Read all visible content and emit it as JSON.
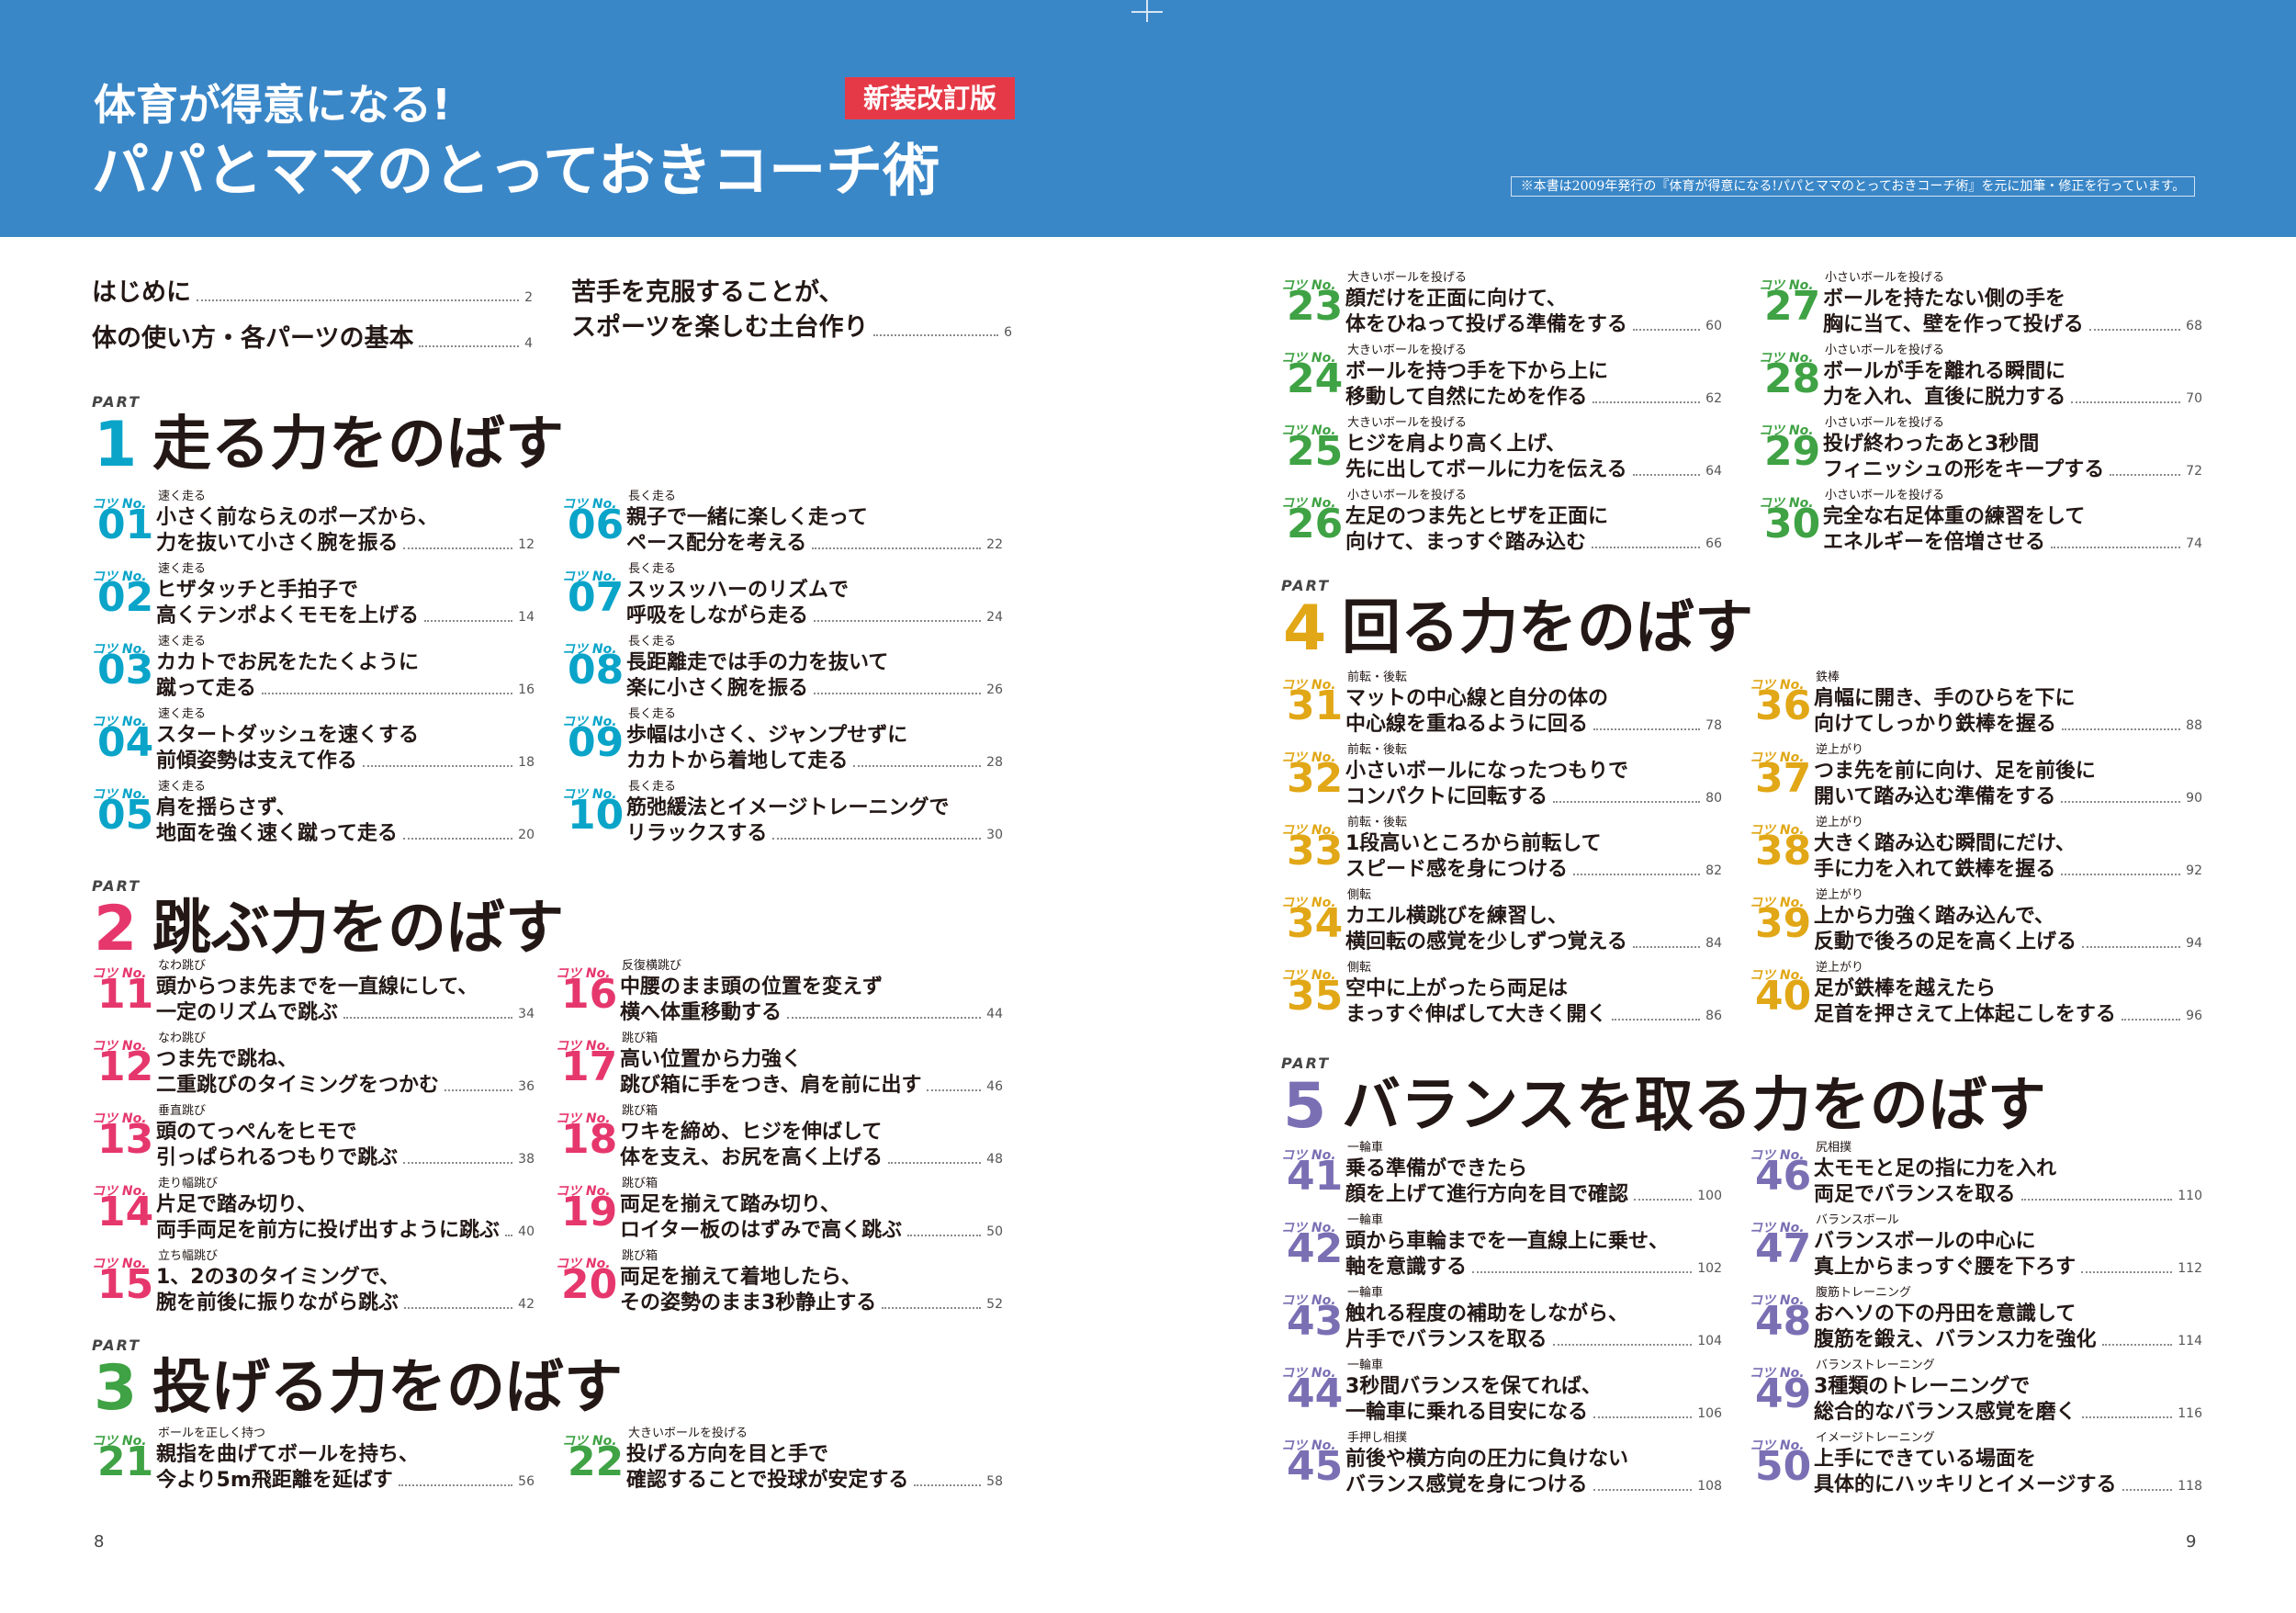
{
  "header": {
    "subtitle": "体育が得意になる!",
    "title": "パパとママのとっておきコーチ術",
    "edition_badge": "新装改訂版",
    "note": "※本書は2009年発行の『体育が得意になる!パパとママのとっておきコーチ術』を元に加筆・修正を行っています。"
  },
  "colors": {
    "banner": "#3a87c8",
    "part1": "#0aa4c9",
    "part2": "#e6376d",
    "part3": "#3fa244",
    "part4": "#e1a716",
    "part5": "#7b6fb4",
    "edition": "#e63947"
  },
  "intro": [
    {
      "title": "はじめに",
      "page": "2"
    },
    {
      "title": "体の使い方・各パーツの基本",
      "page": "4"
    },
    {
      "title": "苦手を克服することが、",
      "title2": "スポーツを楽しむ土台作り",
      "page": "6"
    }
  ],
  "part_label": "PART",
  "tip_label": "コツ No.",
  "parts": [
    {
      "num": "1",
      "title": "走る力をのばす"
    },
    {
      "num": "2",
      "title": "跳ぶ力をのばす"
    },
    {
      "num": "3",
      "title": "投げる力をのばす"
    },
    {
      "num": "4",
      "title": "回る力をのばす"
    },
    {
      "num": "5",
      "title": "バランスを取る力をのばす"
    }
  ],
  "tips": [
    {
      "no": "01",
      "cat": "速く走る",
      "l1": "小さく前ならえのポーズから、",
      "l2": "力を抜いて小さく腕を振る",
      "page": "12"
    },
    {
      "no": "02",
      "cat": "速く走る",
      "l1": "ヒザタッチと手拍子で",
      "l2": "高くテンポよくモモを上げる",
      "page": "14"
    },
    {
      "no": "03",
      "cat": "速く走る",
      "l1": "カカトでお尻をたたくように",
      "l2": "蹴って走る",
      "page": "16"
    },
    {
      "no": "04",
      "cat": "速く走る",
      "l1": "スタートダッシュを速くする",
      "l2": "前傾姿勢は支えて作る",
      "page": "18"
    },
    {
      "no": "05",
      "cat": "速く走る",
      "l1": "肩を揺らさず、",
      "l2": "地面を強く速く蹴って走る",
      "page": "20"
    },
    {
      "no": "06",
      "cat": "長く走る",
      "l1": "親子で一緒に楽しく走って",
      "l2": "ペース配分を考える",
      "page": "22"
    },
    {
      "no": "07",
      "cat": "長く走る",
      "l1": "スッスッハーのリズムで",
      "l2": "呼吸をしながら走る",
      "page": "24"
    },
    {
      "no": "08",
      "cat": "長く走る",
      "l1": "長距離走では手の力を抜いて",
      "l2": "楽に小さく腕を振る",
      "page": "26"
    },
    {
      "no": "09",
      "cat": "長く走る",
      "l1": "歩幅は小さく、ジャンプせずに",
      "l2": "カカトから着地して走る",
      "page": "28"
    },
    {
      "no": "10",
      "cat": "長く走る",
      "l1": "筋弛緩法とイメージトレーニングで",
      "l2": "リラックスする",
      "page": "30"
    },
    {
      "no": "11",
      "cat": "なわ跳び",
      "l1": "頭からつま先までを一直線にして、",
      "l2": "一定のリズムで跳ぶ",
      "page": "34"
    },
    {
      "no": "12",
      "cat": "なわ跳び",
      "l1": "つま先で跳ね、",
      "l2": "二重跳びのタイミングをつかむ",
      "page": "36"
    },
    {
      "no": "13",
      "cat": "垂直跳び",
      "l1": "頭のてっぺんをヒモで",
      "l2": "引っぱられるつもりで跳ぶ",
      "page": "38"
    },
    {
      "no": "14",
      "cat": "走り幅跳び",
      "l1": "片足で踏み切り、",
      "l2": "両手両足を前方に投げ出すように跳ぶ",
      "page": "40"
    },
    {
      "no": "15",
      "cat": "立ち幅跳び",
      "l1": "1、2の3のタイミングで、",
      "l2": "腕を前後に振りながら跳ぶ",
      "page": "42"
    },
    {
      "no": "16",
      "cat": "反復横跳び",
      "l1": "中腰のまま頭の位置を変えず",
      "l2": "横へ体重移動する",
      "page": "44"
    },
    {
      "no": "17",
      "cat": "跳び箱",
      "l1": "高い位置から力強く",
      "l2": "跳び箱に手をつき、肩を前に出す",
      "page": "46"
    },
    {
      "no": "18",
      "cat": "跳び箱",
      "l1": "ワキを締め、ヒジを伸ばして",
      "l2": "体を支え、お尻を高く上げる",
      "page": "48"
    },
    {
      "no": "19",
      "cat": "跳び箱",
      "l1": "両足を揃えて踏み切り、",
      "l2": "ロイター板のはずみで高く跳ぶ",
      "page": "50"
    },
    {
      "no": "20",
      "cat": "跳び箱",
      "l1": "両足を揃えて着地したら、",
      "l2": "その姿勢のまま3秒静止する",
      "page": "52"
    },
    {
      "no": "21",
      "cat": "ボールを正しく持つ",
      "l1": "親指を曲げてボールを持ち、",
      "l2": "今より5m飛距離を延ばす",
      "page": "56"
    },
    {
      "no": "22",
      "cat": "大きいボールを投げる",
      "l1": "投げる方向を目と手で",
      "l2": "確認することで投球が安定する",
      "page": "58"
    },
    {
      "no": "23",
      "cat": "大きいボールを投げる",
      "l1": "顔だけを正面に向けて、",
      "l2": "体をひねって投げる準備をする",
      "page": "60"
    },
    {
      "no": "24",
      "cat": "大きいボールを投げる",
      "l1": "ボールを持つ手を下から上に",
      "l2": "移動して自然にためを作る",
      "page": "62"
    },
    {
      "no": "25",
      "cat": "大きいボールを投げる",
      "l1": "ヒジを肩より高く上げ、",
      "l2": "先に出してボールに力を伝える",
      "page": "64"
    },
    {
      "no": "26",
      "cat": "小さいボールを投げる",
      "l1": "左足のつま先とヒザを正面に",
      "l2": "向けて、まっすぐ踏み込む",
      "page": "66"
    },
    {
      "no": "27",
      "cat": "小さいボールを投げる",
      "l1": "ボールを持たない側の手を",
      "l2": "胸に当て、壁を作って投げる",
      "page": "68"
    },
    {
      "no": "28",
      "cat": "小さいボールを投げる",
      "l1": "ボールが手を離れる瞬間に",
      "l2": "力を入れ、直後に脱力する",
      "page": "70"
    },
    {
      "no": "29",
      "cat": "小さいボールを投げる",
      "l1": "投げ終わったあと3秒間",
      "l2": "フィニッシュの形をキープする",
      "page": "72"
    },
    {
      "no": "30",
      "cat": "小さいボールを投げる",
      "l1": "完全な右足体重の練習をして",
      "l2": "エネルギーを倍増させる",
      "page": "74"
    },
    {
      "no": "31",
      "cat": "前転・後転",
      "l1": "マットの中心線と自分の体の",
      "l2": "中心線を重ねるように回る",
      "page": "78"
    },
    {
      "no": "32",
      "cat": "前転・後転",
      "l1": "小さいボールになったつもりで",
      "l2": "コンパクトに回転する",
      "page": "80"
    },
    {
      "no": "33",
      "cat": "前転・後転",
      "l1": "1段高いところから前転して",
      "l2": "スピード感を身につける",
      "page": "82"
    },
    {
      "no": "34",
      "cat": "側転",
      "l1": "カエル横跳びを練習し、",
      "l2": "横回転の感覚を少しずつ覚える",
      "page": "84"
    },
    {
      "no": "35",
      "cat": "側転",
      "l1": "空中に上がったら両足は",
      "l2": "まっすぐ伸ばして大きく開く",
      "page": "86"
    },
    {
      "no": "36",
      "cat": "鉄棒",
      "l1": "肩幅に開き、手のひらを下に",
      "l2": "向けてしっかり鉄棒を握る",
      "page": "88"
    },
    {
      "no": "37",
      "cat": "逆上がり",
      "l1": "つま先を前に向け、足を前後に",
      "l2": "開いて踏み込む準備をする",
      "page": "90"
    },
    {
      "no": "38",
      "cat": "逆上がり",
      "l1": "大きく踏み込む瞬間にだけ、",
      "l2": "手に力を入れて鉄棒を握る",
      "page": "92"
    },
    {
      "no": "39",
      "cat": "逆上がり",
      "l1": "上から力強く踏み込んで、",
      "l2": "反動で後ろの足を高く上げる",
      "page": "94"
    },
    {
      "no": "40",
      "cat": "逆上がり",
      "l1": "足が鉄棒を越えたら",
      "l2": "足首を押さえて上体起こしをする",
      "page": "96"
    },
    {
      "no": "41",
      "cat": "一輪車",
      "l1": "乗る準備ができたら",
      "l2": "顔を上げて進行方向を目で確認",
      "page": "100"
    },
    {
      "no": "42",
      "cat": "一輪車",
      "l1": "頭から車輪までを一直線上に乗せ、",
      "l2": "軸を意識する",
      "page": "102"
    },
    {
      "no": "43",
      "cat": "一輪車",
      "l1": "触れる程度の補助をしながら、",
      "l2": "片手でバランスを取る",
      "page": "104"
    },
    {
      "no": "44",
      "cat": "一輪車",
      "l1": "3秒間バランスを保てれば、",
      "l2": "一輪車に乗れる目安になる",
      "page": "106"
    },
    {
      "no": "45",
      "cat": "手押し相撲",
      "l1": "前後や横方向の圧力に負けない",
      "l2": "バランス感覚を身につける",
      "page": "108"
    },
    {
      "no": "46",
      "cat": "尻相撲",
      "l1": "太モモと足の指に力を入れ",
      "l2": "両足でバランスを取る",
      "page": "110"
    },
    {
      "no": "47",
      "cat": "バランスボール",
      "l1": "バランスボールの中心に",
      "l2": "真上からまっすぐ腰を下ろす",
      "page": "112"
    },
    {
      "no": "48",
      "cat": "腹筋トレーニング",
      "l1": "おヘソの下の丹田を意識して",
      "l2": "腹筋を鍛え、バランス力を強化",
      "page": "114"
    },
    {
      "no": "49",
      "cat": "バランストレーニング",
      "l1": "3種類のトレーニングで",
      "l2": "総合的なバランス感覚を磨く",
      "page": "116"
    },
    {
      "no": "50",
      "cat": "イメージトレーニング",
      "l1": "上手にできている場面を",
      "l2": "具体的にハッキリとイメージする",
      "page": "118"
    }
  ],
  "folios": {
    "left": "8",
    "right": "9"
  }
}
